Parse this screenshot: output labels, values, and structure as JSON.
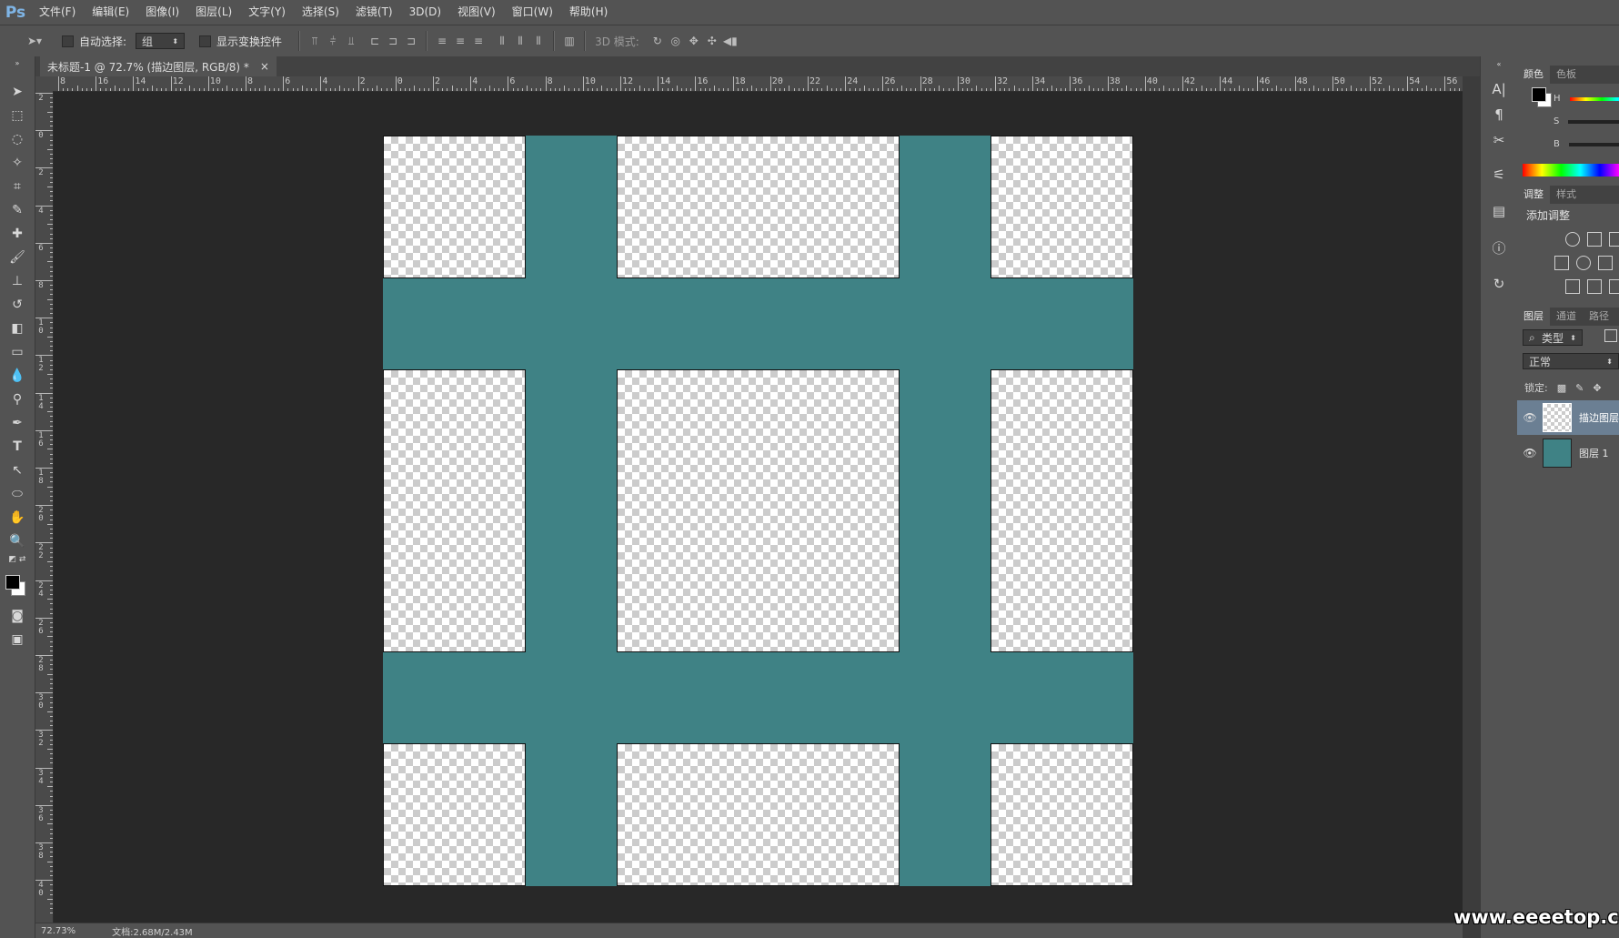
{
  "app": {
    "logo": "Ps"
  },
  "menu": [
    "文件(F)",
    "编辑(E)",
    "图像(I)",
    "图层(L)",
    "文字(Y)",
    "选择(S)",
    "滤镜(T)",
    "3D(D)",
    "视图(V)",
    "窗口(W)",
    "帮助(H)"
  ],
  "options": {
    "auto_select_label": "自动选择:",
    "auto_select_value": "组",
    "show_transform_label": "显示变换控件",
    "mode_3d_label": "3D 模式:"
  },
  "document": {
    "tab_title": "未标题-1 @ 72.7% (描边图层, RGB/8) *",
    "close": "×",
    "canvas_color": "#3f8285"
  },
  "ruler": {
    "h_labels": [
      "8",
      "16",
      "14",
      "12",
      "10",
      "8",
      "6",
      "4",
      "2",
      "0",
      "2",
      "4",
      "6",
      "8",
      "10",
      "12",
      "14",
      "16",
      "18",
      "20",
      "22",
      "24",
      "26",
      "28",
      "30",
      "32",
      "34",
      "36",
      "38",
      "40",
      "42",
      "44",
      "46",
      "48",
      "50",
      "52",
      "54",
      "56"
    ],
    "v_labels": [
      "2",
      "0",
      "2",
      "4",
      "6",
      "8",
      "10",
      "12",
      "14",
      "16",
      "18",
      "20",
      "22",
      "24",
      "26",
      "28",
      "30",
      "32",
      "34",
      "36",
      "38",
      "40"
    ]
  },
  "status": {
    "zoom": "72.73%",
    "doc_info": "文档:2.68M/2.43M"
  },
  "panels": {
    "color_tabs": [
      "颜色",
      "色板"
    ],
    "color_sliders": [
      "H",
      "S",
      "B"
    ],
    "adjust_tabs": [
      "调整",
      "样式"
    ],
    "adjust_title": "添加调整",
    "layers_tabs": [
      "图层",
      "通道",
      "路径"
    ],
    "filter_kind": "类型",
    "blend_mode": "正常",
    "lock_label": "锁定:",
    "layers": [
      {
        "name": "描边图层",
        "selected": true
      },
      {
        "name": "图层 1",
        "selected": false
      }
    ]
  },
  "watermark": "www.eeeetop.com"
}
